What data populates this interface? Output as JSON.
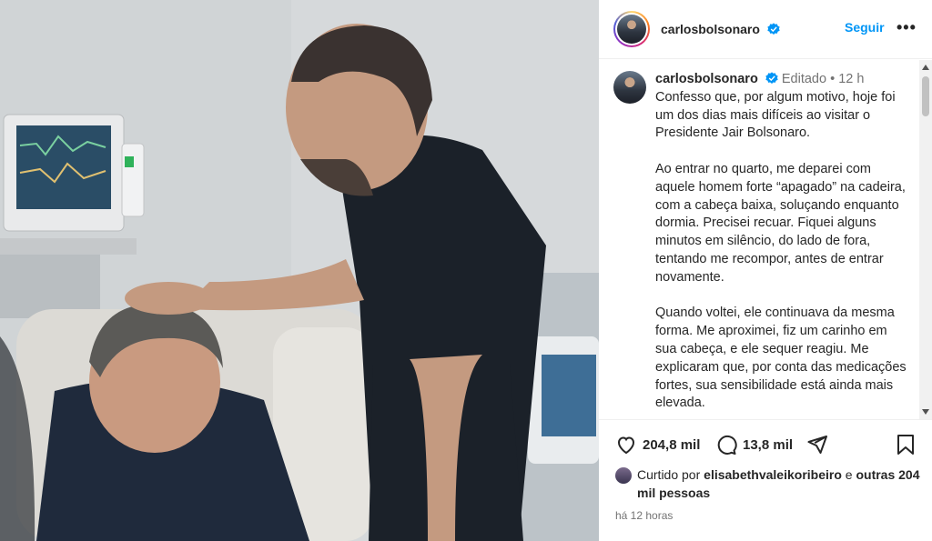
{
  "post": {
    "username": "carlosbolsonaro",
    "follow_label": "Seguir",
    "more_label": "•••",
    "caption": {
      "edited": "Editado",
      "separator": "•",
      "age": "12 h",
      "paragraphs": [
        "Confesso que, por algum motivo, hoje foi um dos dias mais difíceis ao visitar o Presidente Jair Bolsonaro.",
        "Ao entrar no quarto, me deparei com aquele homem forte “apagado” na cadeira, com a cabeça baixa, soluçando enquanto dormia. Precisei recuar. Fiquei alguns minutos em silêncio, do lado de fora, tentando me recompor, antes de entrar novamente.",
        "Quando voltei, ele continuava da mesma forma. Me aproximei, fiz um carinho em sua cabeça, e ele sequer reagiu. Me explicaram que, por conta das medicações fortes, sua sensibilidade está ainda mais elevada."
      ]
    },
    "actions": {
      "likes_count": "204,8 mil",
      "comments_count": "13,8 mil"
    },
    "liked_by": {
      "prefix": "Curtido por",
      "user": "elisabethvaleikoribeiro",
      "conj": "e",
      "others": "outras 204 mil pessoas"
    },
    "timestamp": "há 12 horas"
  },
  "colors": {
    "accent": "#0095f6",
    "text": "#262626",
    "muted": "#737373"
  }
}
